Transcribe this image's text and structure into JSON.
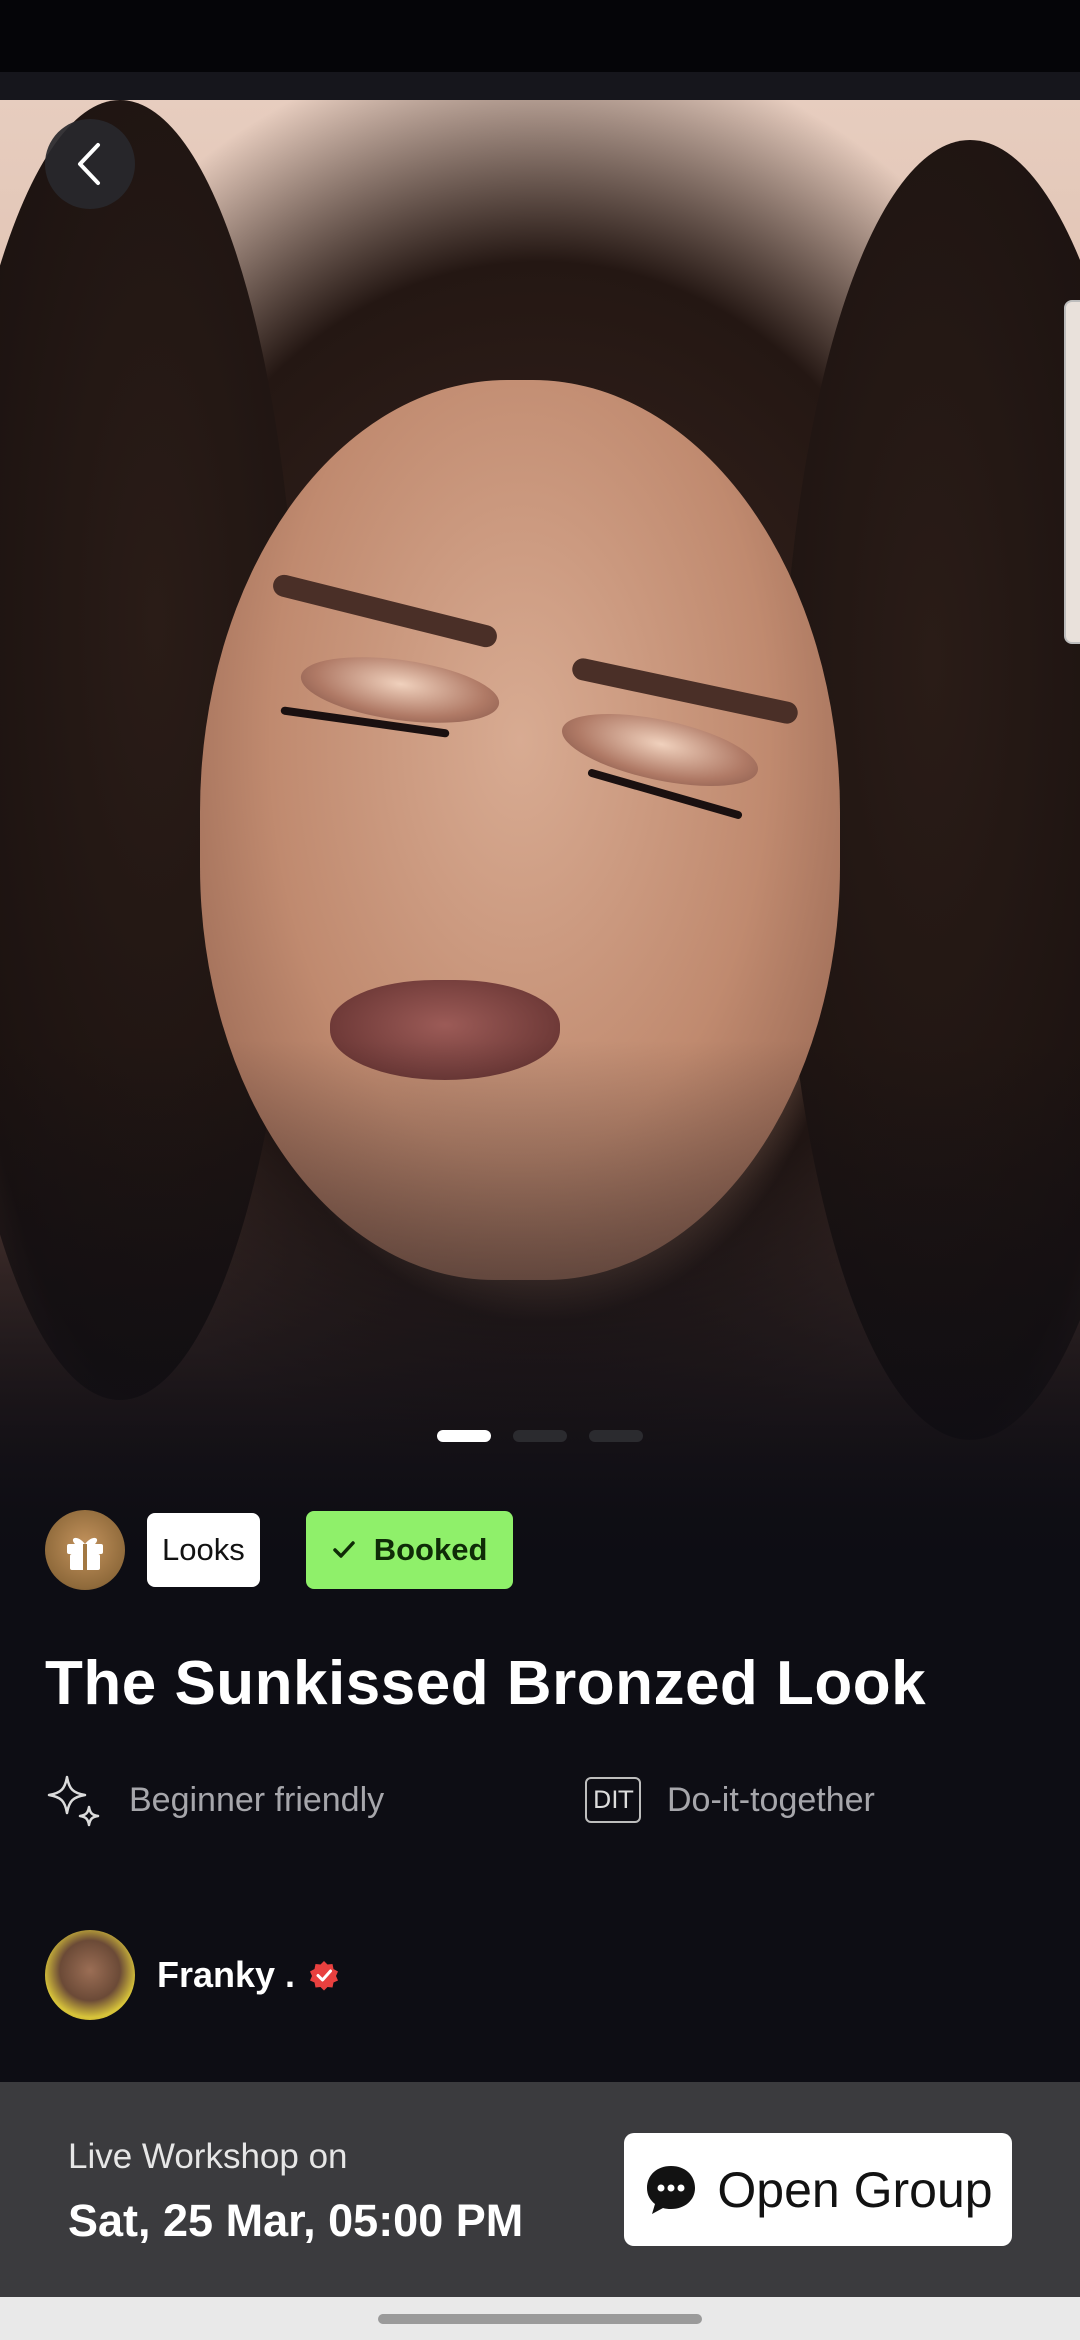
{
  "header": {
    "back_icon": "chevron-left-icon"
  },
  "carousel": {
    "slide_count": 3,
    "active_index": 0
  },
  "tags": {
    "gift_icon": "gift-icon",
    "category": "Looks",
    "booked": "Booked",
    "booked_icon": "check-icon",
    "booked_color": "#8ff06a"
  },
  "title": "The Sunkissed Bronzed Look",
  "features": [
    {
      "icon": "sparkle-icon",
      "label": "Beginner friendly"
    },
    {
      "icon_text": "DIT",
      "label": "Do-it-together"
    }
  ],
  "creator": {
    "name": "Franky .",
    "verified_icon": "verified-badge-icon",
    "verified_color": "#e8403f"
  },
  "footer": {
    "live_label": "Live Workshop on",
    "date": "Sat, 25 Mar, 05:00 PM",
    "cta_label": "Open Group",
    "cta_icon": "chat-bubble-icon"
  }
}
